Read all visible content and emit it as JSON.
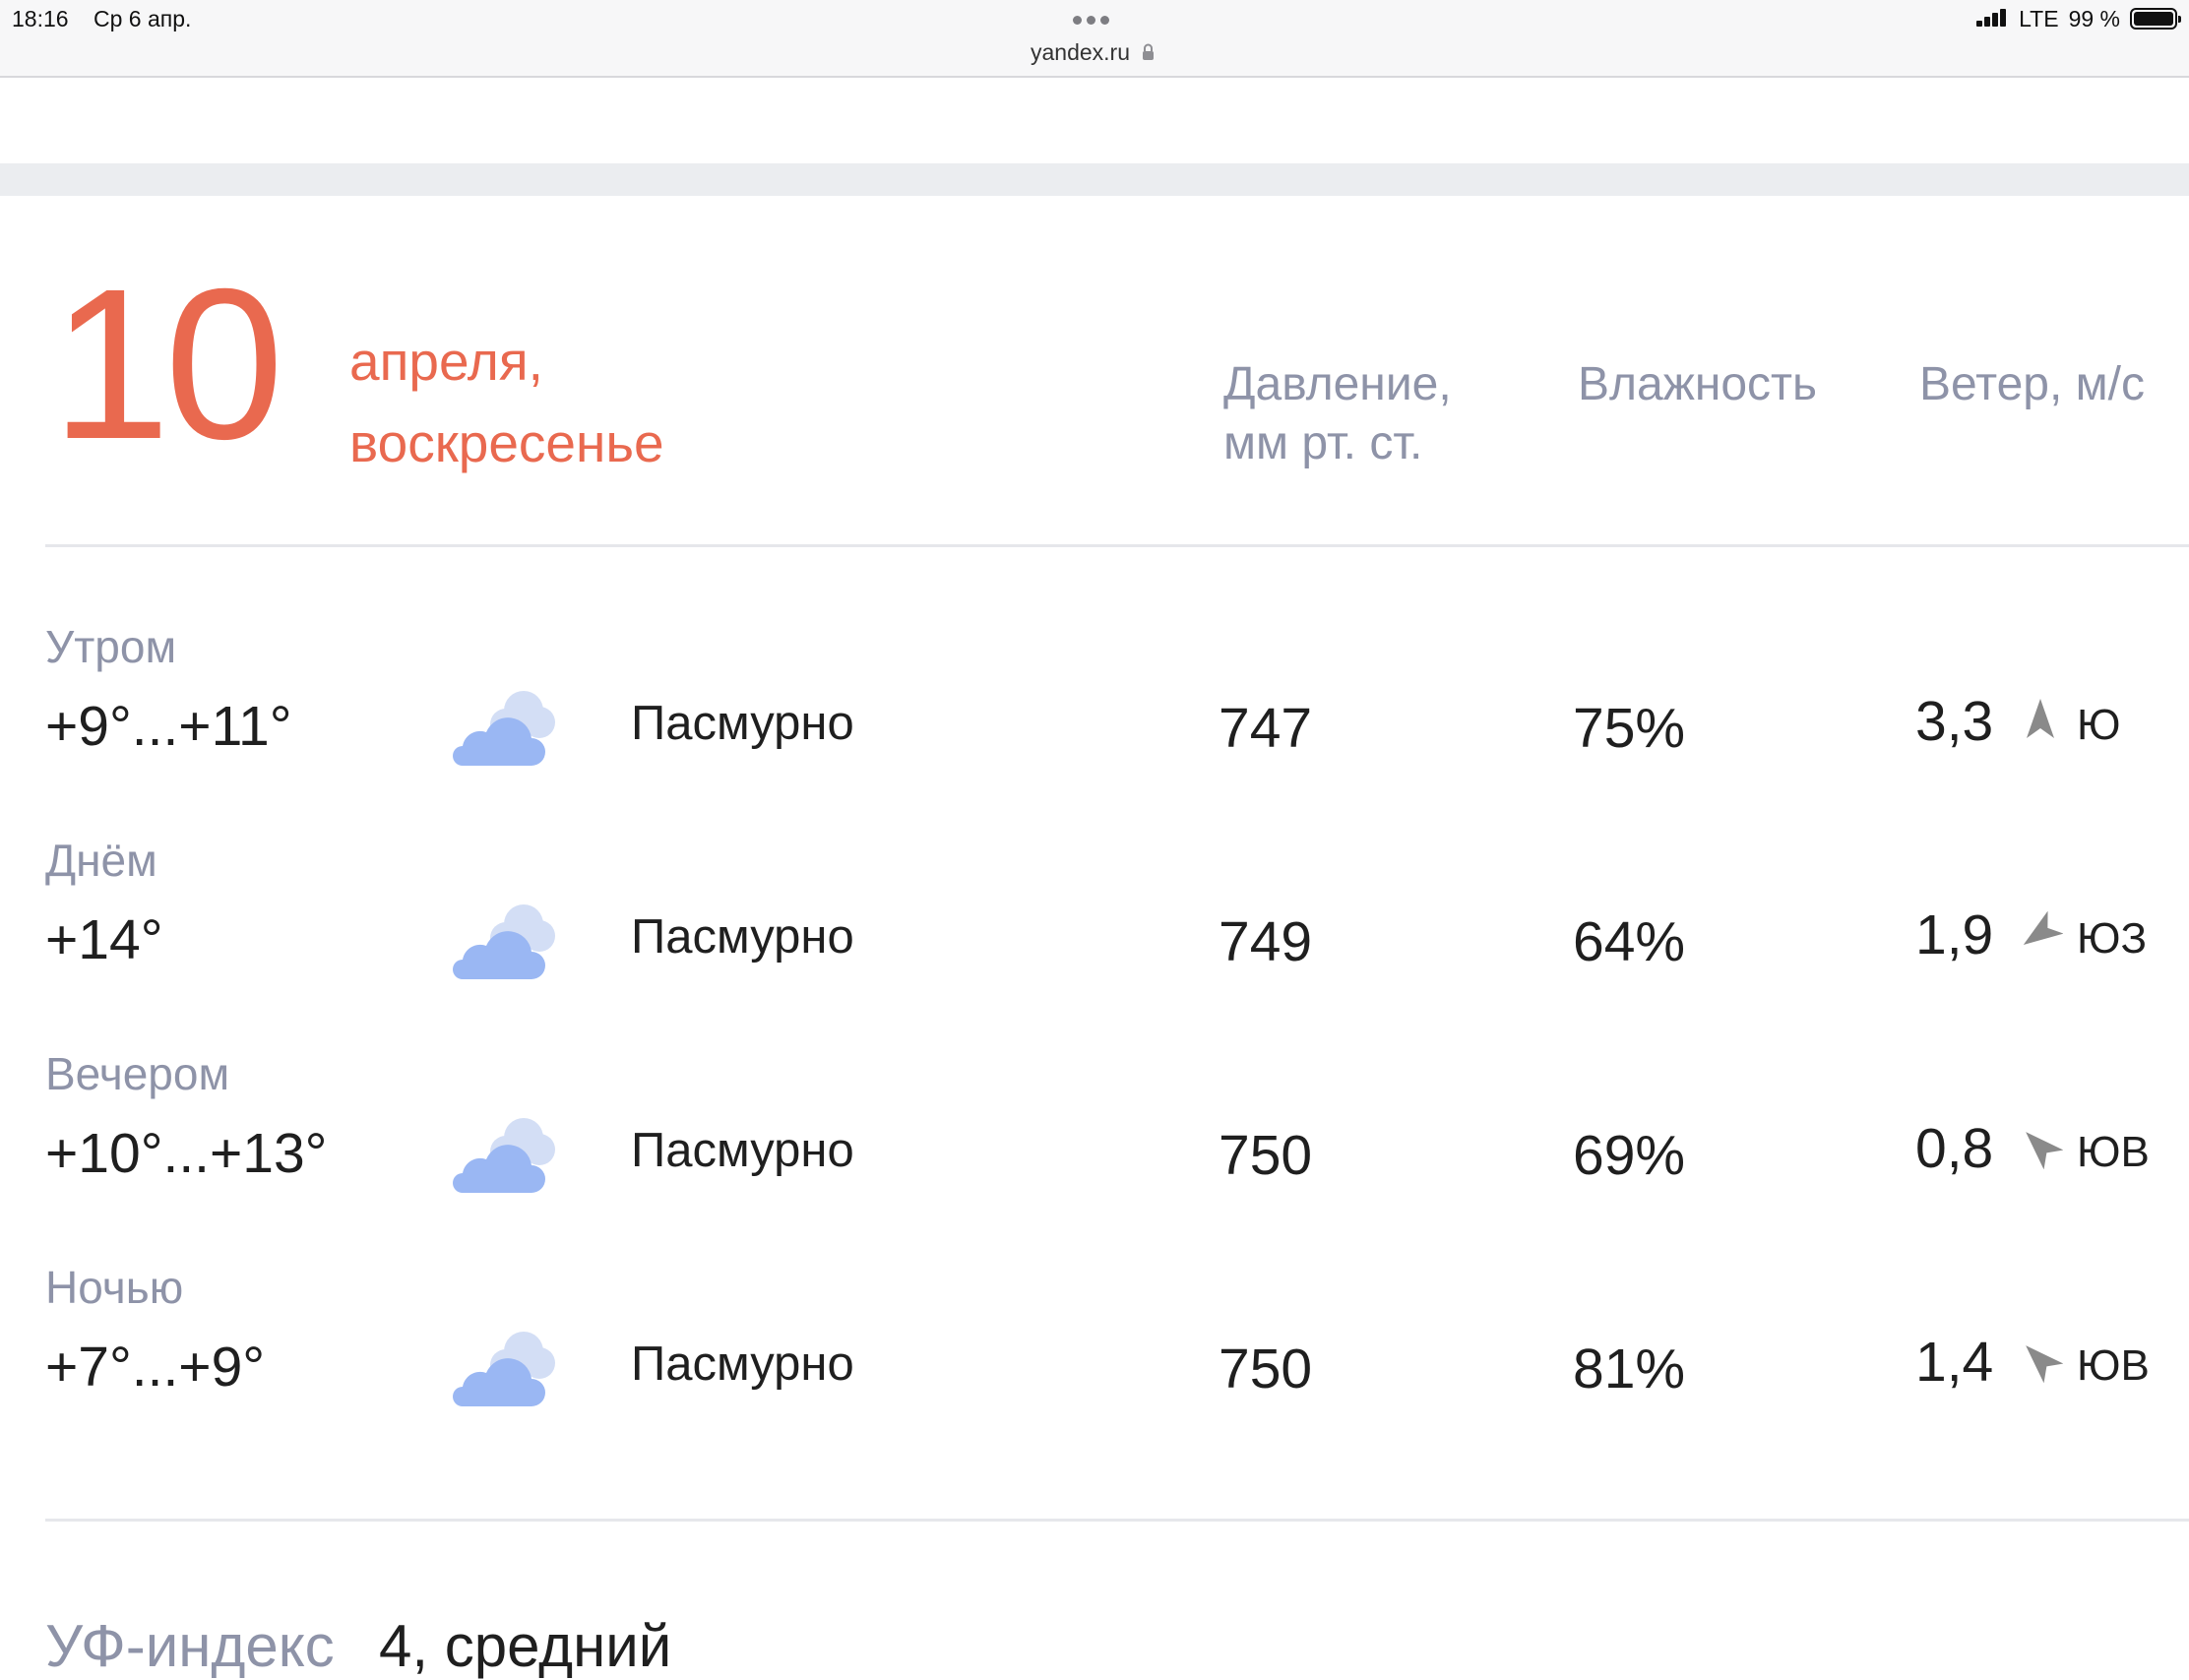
{
  "status_bar": {
    "time": "18:16",
    "date": "Ср 6 апр.",
    "url": "yandex.ru",
    "network": "LTE",
    "battery": "99 %"
  },
  "day": {
    "number": "10",
    "month": "апреля,",
    "weekday": "воскресенье"
  },
  "columns": {
    "pressure_line1": "Давление,",
    "pressure_line2": "мм рт. ст.",
    "humidity": "Влажность",
    "wind": "Ветер, м/с"
  },
  "rows": [
    {
      "period": "Утром",
      "temp": "+9°...+11°",
      "icon": "cloudy-icon",
      "condition": "Пасмурно",
      "pressure": "747",
      "humidity": "75%",
      "wind_speed": "3,3",
      "wind_dir": "Ю"
    },
    {
      "period": "Днём",
      "temp": "+14°",
      "icon": "cloudy-icon",
      "condition": "Пасмурно",
      "pressure": "749",
      "humidity": "64%",
      "wind_speed": "1,9",
      "wind_dir": "ЮЗ"
    },
    {
      "period": "Вечером",
      "temp": "+10°...+13°",
      "icon": "cloudy-icon",
      "condition": "Пасмурно",
      "pressure": "750",
      "humidity": "69%",
      "wind_speed": "0,8",
      "wind_dir": "ЮВ"
    },
    {
      "period": "Ночью",
      "temp": "+7°...+9°",
      "icon": "cloudy-icon",
      "condition": "Пасмурно",
      "pressure": "750",
      "humidity": "81%",
      "wind_speed": "1,4",
      "wind_dir": "ЮВ"
    }
  ],
  "uv": {
    "label": "УФ-индекс",
    "value": "4, средний"
  },
  "colors": {
    "accent": "#e9694f",
    "muted": "#8e93a8",
    "cloud_front": "#9ab7f3",
    "cloud_back": "#d3def5",
    "wind_arrow": "#8a8a8a"
  }
}
